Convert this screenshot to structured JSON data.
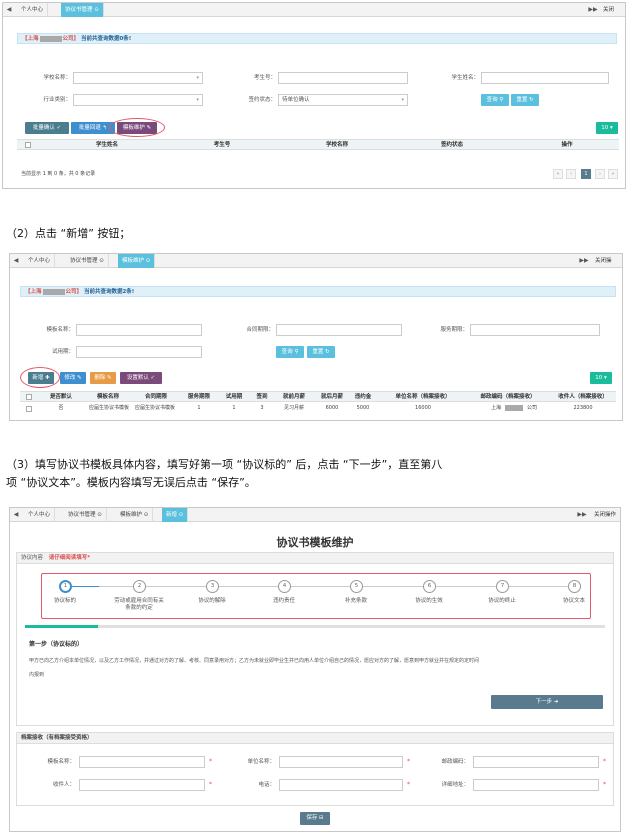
{
  "panel1": {
    "tabs": [
      "个人中心",
      "协议书管理 ⊙"
    ],
    "close": "关闭",
    "info": {
      "prefix": "【上海",
      "suffix": "公司】",
      "text": "当前共查询数据0条!"
    },
    "fields": [
      {
        "label": "学校名称：",
        "value": "",
        "select": true
      },
      {
        "label": "考生号：",
        "value": "",
        "select": false
      },
      {
        "label": "学生姓名：",
        "value": "",
        "select": false
      },
      {
        "label": "行业类别：",
        "value": "",
        "select": true
      },
      {
        "label": "签约状态：",
        "value": "待单位确认",
        "select": true
      }
    ],
    "query_label": "查询",
    "reset_label": "重置",
    "buttons": [
      "批量确认 ✓",
      "批量回退 ↰",
      "模板维护 ✎"
    ],
    "page_size": "10 ▾",
    "columns": [
      "学生姓名",
      "考生号",
      "学校名称",
      "签约状态",
      "操作"
    ],
    "footer": "当前显示 1 到 0 条，共 0 条记录",
    "pager": [
      "«",
      "‹",
      "1",
      "›",
      "»"
    ]
  },
  "caption2": "（2）点击 “新增” 按钮；",
  "panel2": {
    "tabs": [
      "个人中心",
      "协议书管理 ⊙",
      "模板维护 ⊙"
    ],
    "close": "关闭操",
    "info": {
      "prefix": "【上海",
      "suffix": "公司】",
      "text": "当前共查询数据2条!"
    },
    "fields": [
      {
        "label": "模板名称："
      },
      {
        "label": "合同期限："
      },
      {
        "label": "服务期限："
      },
      {
        "label": "试用期："
      }
    ],
    "query_label": "查询",
    "reset_label": "重置",
    "buttons": [
      "新增 ✚",
      "修改 ✎",
      "删除 ✎",
      "设置默认 ✓"
    ],
    "page_size": "10 ▾",
    "columns": [
      "是否默认",
      "模板名称",
      "合同期限",
      "服务期限",
      "试用期",
      "签到",
      "就前月薪",
      "就后月薪",
      "违约金",
      "单位名称（档案接收）",
      "邮政编码（档案接收）",
      "收件人（档案接收）"
    ],
    "row": [
      "否",
      "应届生协议书模板",
      "应届生协议书模板",
      "1",
      "1",
      "3",
      "见习月薪",
      "6000",
      "5000",
      "16000",
      "上海",
      "公司",
      "223800"
    ]
  },
  "caption3_line1": "（3）填写协议书模板具体内容，填写好第一项 “协议标的” 后，点击 “下一步”，直至第八",
  "caption3_line2": "项 “协议文本”。模板内容填写无误后点击 “保存”。",
  "panel3": {
    "tabs": [
      "个人中心",
      "协议书管理 ⊙",
      "模板维护 ⊙",
      "新增 ⊙"
    ],
    "close": "关闭操作",
    "title": "协议书模板维护",
    "section_label": "协议内容",
    "section_hint": "请仔细阅读填写*",
    "steps": [
      {
        "num": "1",
        "label": "协议标的"
      },
      {
        "num": "2",
        "label": "劳动或雇用合同有关条款的约定"
      },
      {
        "num": "3",
        "label": "协议的解除"
      },
      {
        "num": "4",
        "label": "违约责任"
      },
      {
        "num": "5",
        "label": "补充条款"
      },
      {
        "num": "6",
        "label": "协议的生效"
      },
      {
        "num": "7",
        "label": "协议的终止"
      },
      {
        "num": "8",
        "label": "协议文本"
      }
    ],
    "step_heading": "第一步（协议标的）",
    "step_text_1": "甲方已向乙方介绍本单位情况，以及乙方工作情况，并通过对方的了解、考核、同意录用对方；乙方为未就业即毕业生并已向用人单位介绍自己的情况，愿应对方的了解，愿意到甲方就业并在规定的定时间",
    "step_text_2": "内报到",
    "next_label": "下一步 ➜",
    "archive_title": "档案接收（有档案接受资格）",
    "archive_fields": [
      "模板名称：",
      "单位名称：",
      "邮政编码：",
      "收件人：",
      "电话：",
      "详细地址："
    ],
    "save_label": "保存 ⊟"
  }
}
